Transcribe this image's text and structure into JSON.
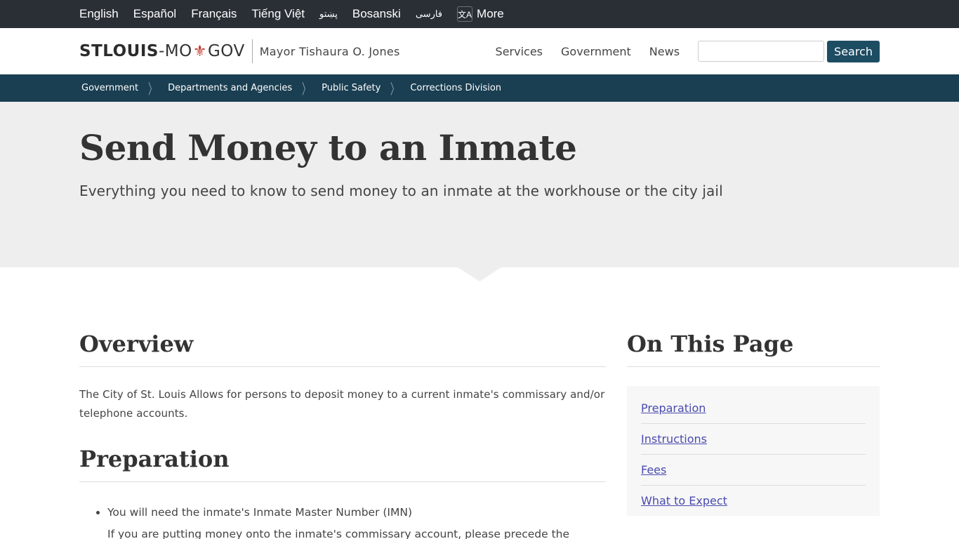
{
  "language_bar": {
    "languages": [
      "English",
      "Español",
      "Français",
      "Tiếng Việt",
      "پښتو",
      "Bosanski",
      "فارسی"
    ],
    "more_label": "More",
    "more_icon": "translate-icon"
  },
  "header": {
    "logo_part1": "STLOUIS",
    "logo_part2": "-MO",
    "logo_symbol": "⚜",
    "logo_part3": "GOV",
    "mayor": "Mayor Tishaura O. Jones",
    "nav": [
      "Services",
      "Government",
      "News"
    ],
    "search_value": "",
    "search_placeholder": "",
    "search_button": "Search"
  },
  "breadcrumb": [
    "Government",
    "Departments and Agencies",
    "Public Safety",
    "Corrections Division"
  ],
  "hero": {
    "title": "Send Money to an Inmate",
    "subtitle": "Everything you need to know to send money to an inmate at the workhouse or the city jail"
  },
  "main": {
    "overview_heading": "Overview",
    "overview_text": "The City of St. Louis Allows for persons to deposit money to a current inmate's commissary and/or telephone accounts.",
    "preparation_heading": "Preparation",
    "preparation_items": [
      "You will need the inmate's Inmate Master Number (IMN)"
    ],
    "preparation_continuation": "If you are putting money onto the inmate's commissary account, please precede the"
  },
  "sidebar": {
    "heading": "On This Page",
    "links": [
      "Preparation",
      "Instructions",
      "Fees",
      "What to Expect"
    ]
  },
  "colors": {
    "top_bar": "#2a2f36",
    "breadcrumb_bar": "#1a3e52",
    "search_button": "#1d4d63",
    "hero_bg": "#eeeeee",
    "link": "#4a4ab0",
    "logo_accent": "#c0392b"
  }
}
